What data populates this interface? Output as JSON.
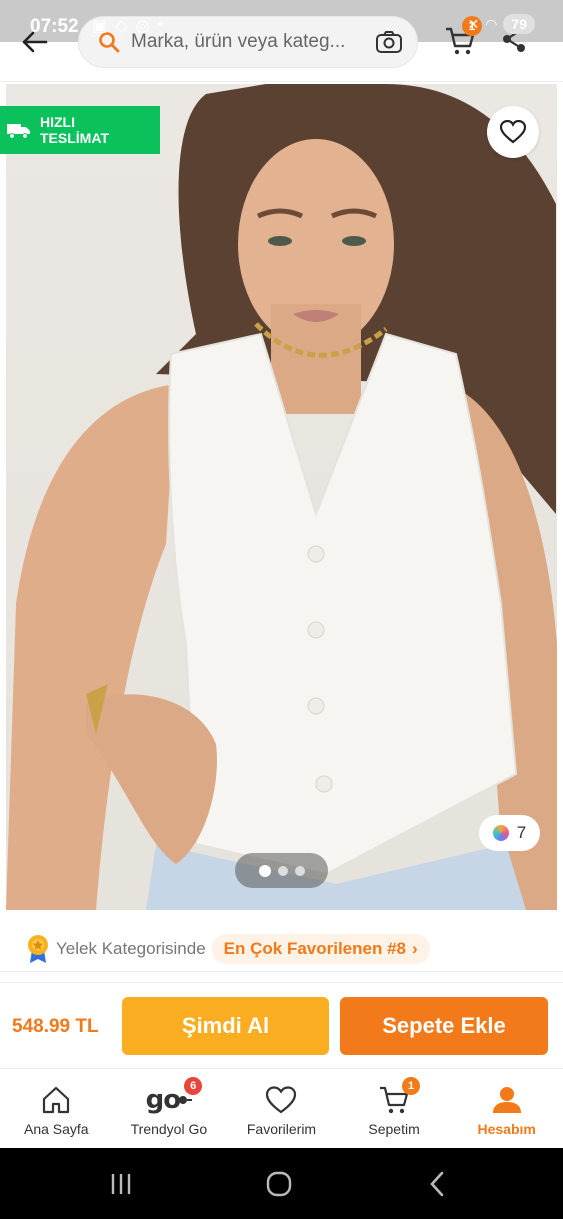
{
  "status_bar": {
    "time": "07:52",
    "battery": "79",
    "icons_left": [
      "screenshot-icon",
      "location-icon",
      "instagram-icon",
      "dot"
    ],
    "icons_right": [
      "mute-icon",
      "wifi-icon",
      "signal-icon"
    ]
  },
  "header": {
    "search_placeholder": "Marka, ürün veya kateg...",
    "cart_badge": "1"
  },
  "product_image": {
    "fast_delivery_line1": "HIZLI",
    "fast_delivery_line2": "TESLİMAT",
    "color_count": "7",
    "pager_total": 3,
    "pager_active": 1
  },
  "category": {
    "text": "Yelek Kategorisinde",
    "chip": "En Çok Favorilenen #8",
    "chip_arrow": "›"
  },
  "buy_bar": {
    "price": "548.99 TL",
    "buy_now": "Şimdi Al",
    "add_to_cart": "Sepete Ekle"
  },
  "bottom_nav": {
    "items": [
      {
        "label": "Ana Sayfa",
        "icon": "home-icon"
      },
      {
        "label": "Trendyol Go",
        "icon": "go-logo-icon",
        "badge": "6"
      },
      {
        "label": "Favorilerim",
        "icon": "heart-icon"
      },
      {
        "label": "Sepetim",
        "icon": "cart-icon",
        "badge": "1"
      },
      {
        "label": "Hesabım",
        "icon": "user-icon",
        "active": true
      }
    ]
  },
  "colors": {
    "brand_orange": "#f27a1a",
    "buy_now_yellow": "#fbad22",
    "fast_delivery_green": "#0bc15c",
    "go_badge_red": "#e8453c"
  }
}
